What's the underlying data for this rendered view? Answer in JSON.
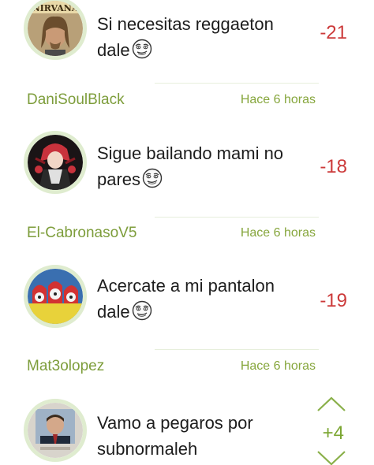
{
  "comments": [
    {
      "text": "Si necesitas reggaeton dale",
      "score": "-21",
      "avatar_text": "NIRVANA",
      "meme_icon": "me-gusta-face-icon"
    },
    {
      "username": "DaniSoulBlack",
      "timestamp": "Hace 6 horas",
      "text": "Sigue bailando mami no pares",
      "score": "-18",
      "meme_icon": "me-gusta-face-icon"
    },
    {
      "username": "El-CabronasoV5",
      "timestamp": "Hace 6 horas",
      "text": "Acercate a mi pantalon dale",
      "score": "-19",
      "meme_icon": "me-gusta-face-icon"
    },
    {
      "username": "Mat3olopez",
      "timestamp": "Hace 6 horas",
      "text": "Vamo a pegaros por subnormaleh",
      "score": "+4"
    }
  ],
  "colors": {
    "negative_score": "#cc3a3a",
    "positive_score": "#7ba632",
    "username": "#7d9d3b",
    "avatar_ring": "#dfeccf"
  },
  "icons": {
    "upvote": "chevron-up-icon",
    "downvote": "chevron-down-icon"
  }
}
